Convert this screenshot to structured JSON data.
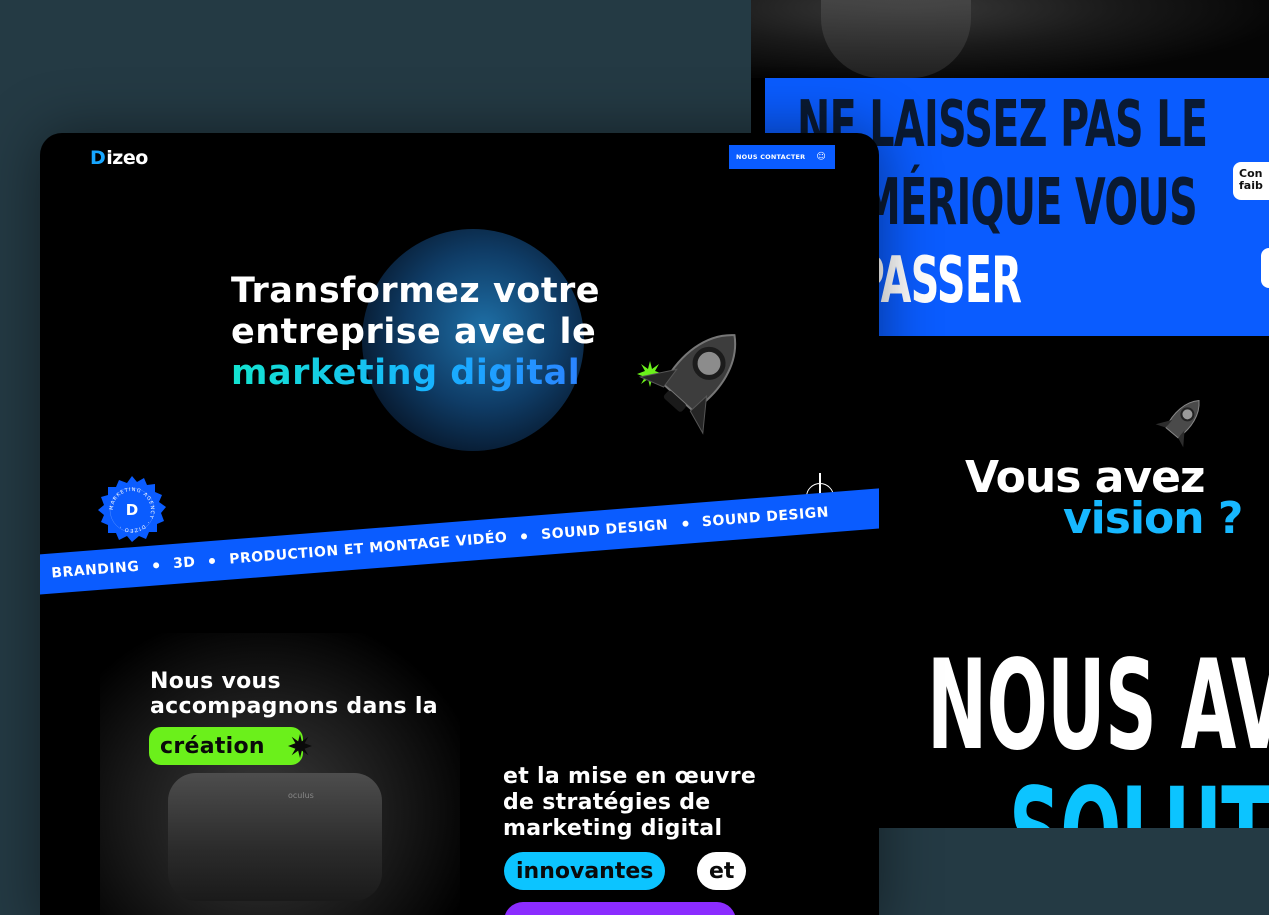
{
  "back_mockup": {
    "banner": {
      "line1": "NE LAISSEZ PAS LE",
      "line2": "NUMÉRIQUE VOUS",
      "line3": "DÉPASSER"
    },
    "contact_pill": {
      "line1": "Con",
      "line2": "faib"
    },
    "vous_avez": "Vous avez",
    "vision": "vision ?",
    "nous_avons": "NOUS AVONS",
    "solution": "SOLUTIONS"
  },
  "front_mockup": {
    "logo": {
      "mark": "D",
      "text": "izeo"
    },
    "contact_button": {
      "label": "NOUS CONTACTER",
      "icon": "smile-icon"
    },
    "hero": {
      "line1": "Transformez votre",
      "line2": "entreprise avec le",
      "line3": "marketing digital"
    },
    "badge": {
      "text": "MARKETING AGENCY · DIZEO ·",
      "mark": "D"
    },
    "ribbon": [
      "BRANDING",
      "3D",
      "PRODUCTION ET MONTAGE VIDÉO",
      "SOUND DESIGN",
      "SOUND DESIGN"
    ],
    "accompany": {
      "line1": "Nous vous",
      "line2": "accompagnons dans la"
    },
    "pill_creation": "création",
    "strategy": {
      "line1": "et la mise en œuvre",
      "line2": "de stratégies de",
      "line3": "marketing digital"
    },
    "pill_innovantes": "innovantes",
    "pill_et": "et",
    "headset_brand": "oculus"
  },
  "colors": {
    "background": "#243a44",
    "brand_blue": "#0a5cff",
    "cyan": "#0cc4ff",
    "lime": "#6bf01b",
    "purple": "#8b2cff"
  }
}
